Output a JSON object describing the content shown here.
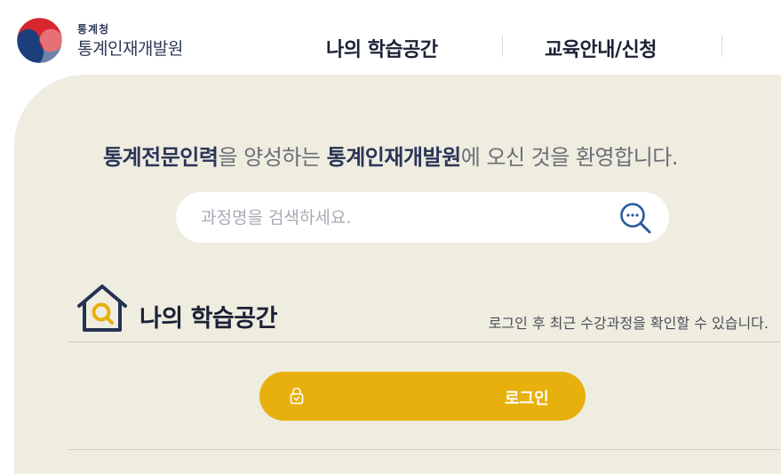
{
  "header": {
    "logo": {
      "agency": "통계청",
      "title": "통계인재개발원"
    },
    "nav": [
      {
        "label": "나의 학습공간"
      },
      {
        "label": "교육안내/신청"
      }
    ]
  },
  "welcome": {
    "part1": "통계전문인력",
    "part2": "을 양성하는 ",
    "part3": "통계인재개발원",
    "part4": "에 오신 것을 환영합니다."
  },
  "search": {
    "placeholder": "과정명을 검색하세요.",
    "value": ""
  },
  "my_learning": {
    "title": "나의 학습공간",
    "description": "로그인 후 최근 수강과정을 확인할 수 있습니다.",
    "login_label": "로그인"
  },
  "colors": {
    "accent": "#e8b00c",
    "background": "#efece0",
    "navy": "#2a3658"
  },
  "icons": {
    "logo": "taegeuk-emblem-icon",
    "search": "search-magnifier-icon",
    "section": "house-search-icon",
    "lock": "lock-icon"
  }
}
